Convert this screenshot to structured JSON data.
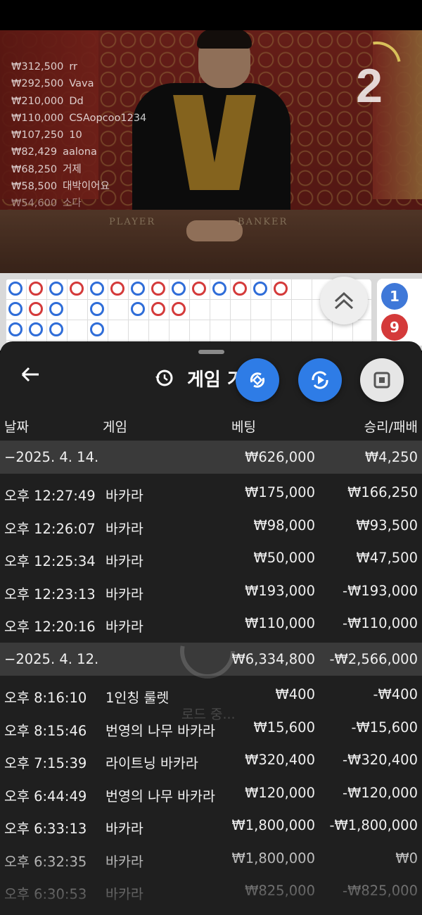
{
  "video": {
    "round_number": "2",
    "table_labels": [
      "PLAYER",
      "BANKER"
    ],
    "bets": [
      {
        "amount": "₩312,500",
        "user": "rr"
      },
      {
        "amount": "₩292,500",
        "user": "Vava"
      },
      {
        "amount": "₩210,000",
        "user": "Dd"
      },
      {
        "amount": "₩110,000",
        "user": "CSAopcoo1234"
      },
      {
        "amount": "₩107,250",
        "user": "10"
      },
      {
        "amount": "₩82,429",
        "user": "aalona"
      },
      {
        "amount": "₩68,250",
        "user": "거제"
      },
      {
        "amount": "₩58,500",
        "user": "대박이어요"
      },
      {
        "amount": "₩54,600",
        "user": "소다"
      }
    ]
  },
  "roadmap": {
    "side_values": [
      "1",
      "9"
    ]
  },
  "sheet": {
    "title": "게임 기",
    "columns": {
      "date": "날짜",
      "game": "게임",
      "bet": "베팅",
      "result": "승리/패배"
    },
    "groups": [
      {
        "date": "−2025. 4. 14.",
        "bet": "₩626,000",
        "result": "₩4,250",
        "rows": [
          {
            "time": "오후 12:27:49",
            "game": "바카라",
            "bet": "₩175,000",
            "result": "₩166,250"
          },
          {
            "time": "오후 12:26:07",
            "game": "바카라",
            "bet": "₩98,000",
            "result": "₩93,500"
          },
          {
            "time": "오후 12:25:34",
            "game": "바카라",
            "bet": "₩50,000",
            "result": "₩47,500"
          },
          {
            "time": "오후 12:23:13",
            "game": "바카라",
            "bet": "₩193,000",
            "result": "-₩193,000"
          },
          {
            "time": "오후 12:20:16",
            "game": "바카라",
            "bet": "₩110,000",
            "result": "-₩110,000"
          }
        ]
      },
      {
        "date": "−2025. 4. 12.",
        "bet": "₩6,334,800",
        "result": "-₩2,566,000",
        "rows": [
          {
            "time": "오후 8:16:10",
            "game": "1인칭 룰렛",
            "bet": "₩400",
            "result": "-₩400"
          },
          {
            "time": "오후 8:15:46",
            "game": "번영의 나무 바카라",
            "bet": "₩15,600",
            "result": "-₩15,600"
          },
          {
            "time": "오후 7:15:39",
            "game": "라이트닝 바카라",
            "bet": "₩320,400",
            "result": "-₩320,400"
          },
          {
            "time": "오후 6:44:49",
            "game": "번영의 나무 바카라",
            "bet": "₩120,000",
            "result": "-₩120,000"
          },
          {
            "time": "오후 6:33:13",
            "game": "바카라",
            "bet": "₩1,800,000",
            "result": "-₩1,800,000"
          },
          {
            "time": "오후 6:32:35",
            "game": "바카라",
            "bet": "₩1,800,000",
            "result": "₩0"
          },
          {
            "time": "오후 6:30:53",
            "game": "바카라",
            "bet": "₩825,000",
            "result": "-₩825,000"
          }
        ]
      }
    ],
    "loading_text": "로드 중..."
  },
  "colors": {
    "blue": "#2e7ce6",
    "red": "#d43a3a",
    "sheet_bg": "#1f1f1f",
    "group_bg": "#3a3a3a"
  },
  "icons": [
    "back-arrow-icon",
    "history-clock-icon",
    "rotate-icon",
    "play-icon",
    "stop-icon",
    "chevron-up-icon"
  ]
}
